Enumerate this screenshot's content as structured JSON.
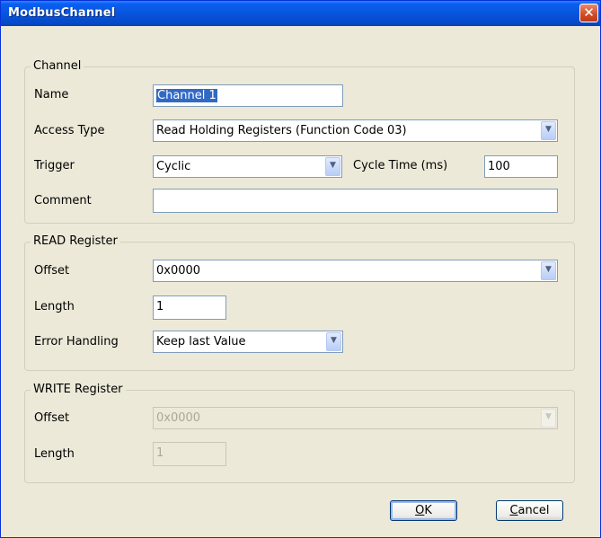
{
  "window": {
    "title": "ModbusChannel",
    "close_glyph": "✕"
  },
  "channel": {
    "legend": "Channel",
    "name_label": "Name",
    "name_value": "Channel 1",
    "access_label": "Access Type",
    "access_value": "Read Holding Registers (Function Code 03)",
    "trigger_label": "Trigger",
    "trigger_value": "Cyclic",
    "cycle_label": "Cycle Time (ms)",
    "cycle_value": "100",
    "comment_label": "Comment",
    "comment_value": ""
  },
  "read": {
    "legend": "READ Register",
    "offset_label": "Offset",
    "offset_value": "0x0000",
    "length_label": "Length",
    "length_value": "1",
    "error_label": "Error Handling",
    "error_value": "Keep last Value"
  },
  "write": {
    "legend": "WRITE Register",
    "offset_label": "Offset",
    "offset_value": "0x0000",
    "length_label": "Length",
    "length_value": "1"
  },
  "buttons": {
    "ok_mnemonic": "O",
    "ok_rest": "K",
    "cancel_mnemonic": "C",
    "cancel_rest": "ancel"
  },
  "icons": {
    "dropdown": "chevron-down-icon",
    "close": "close-icon"
  },
  "colors": {
    "titlebar": "#0855dd",
    "dialog_bg": "#ece9d8",
    "selection": "#316ac5",
    "close_button": "#d04a24"
  }
}
